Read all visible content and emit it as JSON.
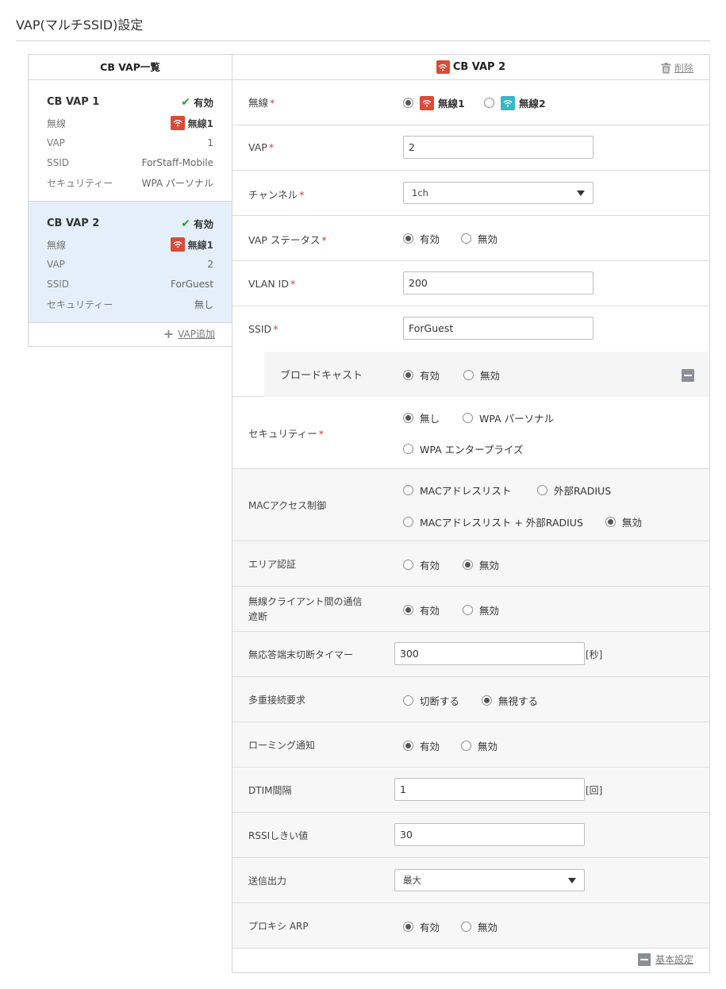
{
  "page": {
    "title": "VAP(マルチSSID)設定"
  },
  "list": {
    "header": "CB VAP一覧",
    "labels": {
      "radio": "無線",
      "vap": "VAP",
      "ssid": "SSID",
      "security": "セキュリティー"
    },
    "items": [
      {
        "name": "CB VAP 1",
        "status": "有効",
        "radio": "無線1",
        "vap": "1",
        "ssid": "ForStaff-Mobile",
        "security": "WPA パーソナル"
      },
      {
        "name": "CB VAP 2",
        "status": "有効",
        "radio": "無線1",
        "vap": "2",
        "ssid": "ForGuest",
        "security": "無し"
      }
    ],
    "add_label": "VAP追加"
  },
  "detail": {
    "header": "CB VAP 2",
    "delete_label": "削除",
    "req_mark": "*",
    "radio_label": "無線",
    "radio_opts": [
      "無線1",
      "無線2"
    ],
    "vap_label": "VAP",
    "vap_value": "2",
    "channel_label": "チャンネル",
    "channel_value": "1ch",
    "vap_status_label": "VAP ステータス",
    "enabled": "有効",
    "disabled": "無効",
    "vlan_label": "VLAN ID",
    "vlan_value": "200",
    "ssid_label": "SSID",
    "ssid_value": "ForGuest",
    "broadcast_label": "ブロードキャスト",
    "security_label": "セキュリティー",
    "security_opts": [
      "無し",
      "WPA パーソナル",
      "WPA エンタープライズ"
    ],
    "mac_label": "MACアクセス制御",
    "mac_opts": [
      "MACアドレスリスト",
      "外部RADIUS",
      "MACアドレスリスト + 外部RADIUS",
      "無効"
    ],
    "area_auth_label": "エリア認証",
    "isolation_label_1": "無線クライアント間の通信",
    "isolation_label_2": "遮断",
    "timer_label": "無応答端末切断タイマー",
    "timer_value": "300",
    "timer_unit": "[秒]",
    "multi_label": "多重接続要求",
    "multi_opts": [
      "切断する",
      "無視する"
    ],
    "roaming_label": "ローミング通知",
    "dtim_label": "DTIM間隔",
    "dtim_value": "1",
    "dtim_unit": "[回]",
    "rssi_label": "RSSIしきい値",
    "rssi_value": "30",
    "power_label": "送信出力",
    "power_value": "最大",
    "proxy_label": "プロキシ ARP",
    "basic_label": "基本設定"
  },
  "colors": {
    "radio1_badge": "#dc4a38",
    "radio2_badge": "#3ab6c6",
    "selected_row": "#e4eff9",
    "required": "#d9383a",
    "check": "#2e9a3c"
  }
}
